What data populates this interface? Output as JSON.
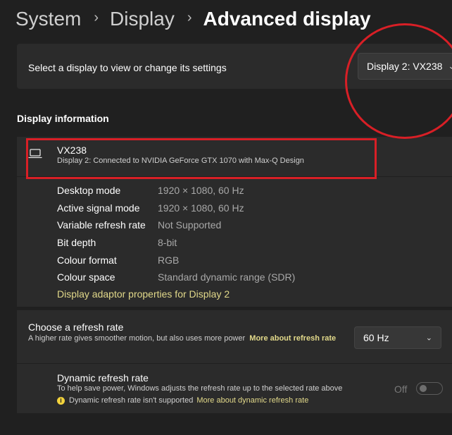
{
  "breadcrumb": {
    "items": [
      "System",
      "Display"
    ],
    "current": "Advanced display",
    "separator": "›"
  },
  "display_select": {
    "label": "Select a display to view or change its settings",
    "value": "Display 2: VX238"
  },
  "display_information": {
    "title": "Display information",
    "name": "VX238",
    "description": "Display 2: Connected to NVIDIA GeForce GTX 1070 with Max-Q Design",
    "rows": [
      {
        "label": "Desktop mode",
        "value": "1920 × 1080, 60 Hz"
      },
      {
        "label": "Active signal mode",
        "value": "1920 × 1080, 60 Hz"
      },
      {
        "label": "Variable refresh rate",
        "value": "Not Supported"
      },
      {
        "label": "Bit depth",
        "value": "8-bit"
      },
      {
        "label": "Colour format",
        "value": "RGB"
      },
      {
        "label": "Colour space",
        "value": "Standard dynamic range (SDR)"
      }
    ],
    "adapter_link": "Display adaptor properties for Display 2"
  },
  "refresh_rate": {
    "title": "Choose a refresh rate",
    "description": "A higher rate gives smoother motion, but also uses more power",
    "link": "More about refresh rate",
    "value": "60 Hz"
  },
  "dynamic_refresh": {
    "title": "Dynamic refresh rate",
    "description": "To help save power, Windows adjusts the refresh rate up to the selected rate above",
    "note": "Dynamic refresh rate isn't supported",
    "link": "More about dynamic refresh rate",
    "toggle_label": "Off",
    "toggle_on": false
  },
  "colors": {
    "background": "#202020",
    "card": "#2b2b2b",
    "link": "#e2d98a",
    "annotation": "#d81f26"
  },
  "icons": {
    "laptop": "laptop-icon",
    "chevron": "chevron-down-icon",
    "info": "info-icon"
  }
}
